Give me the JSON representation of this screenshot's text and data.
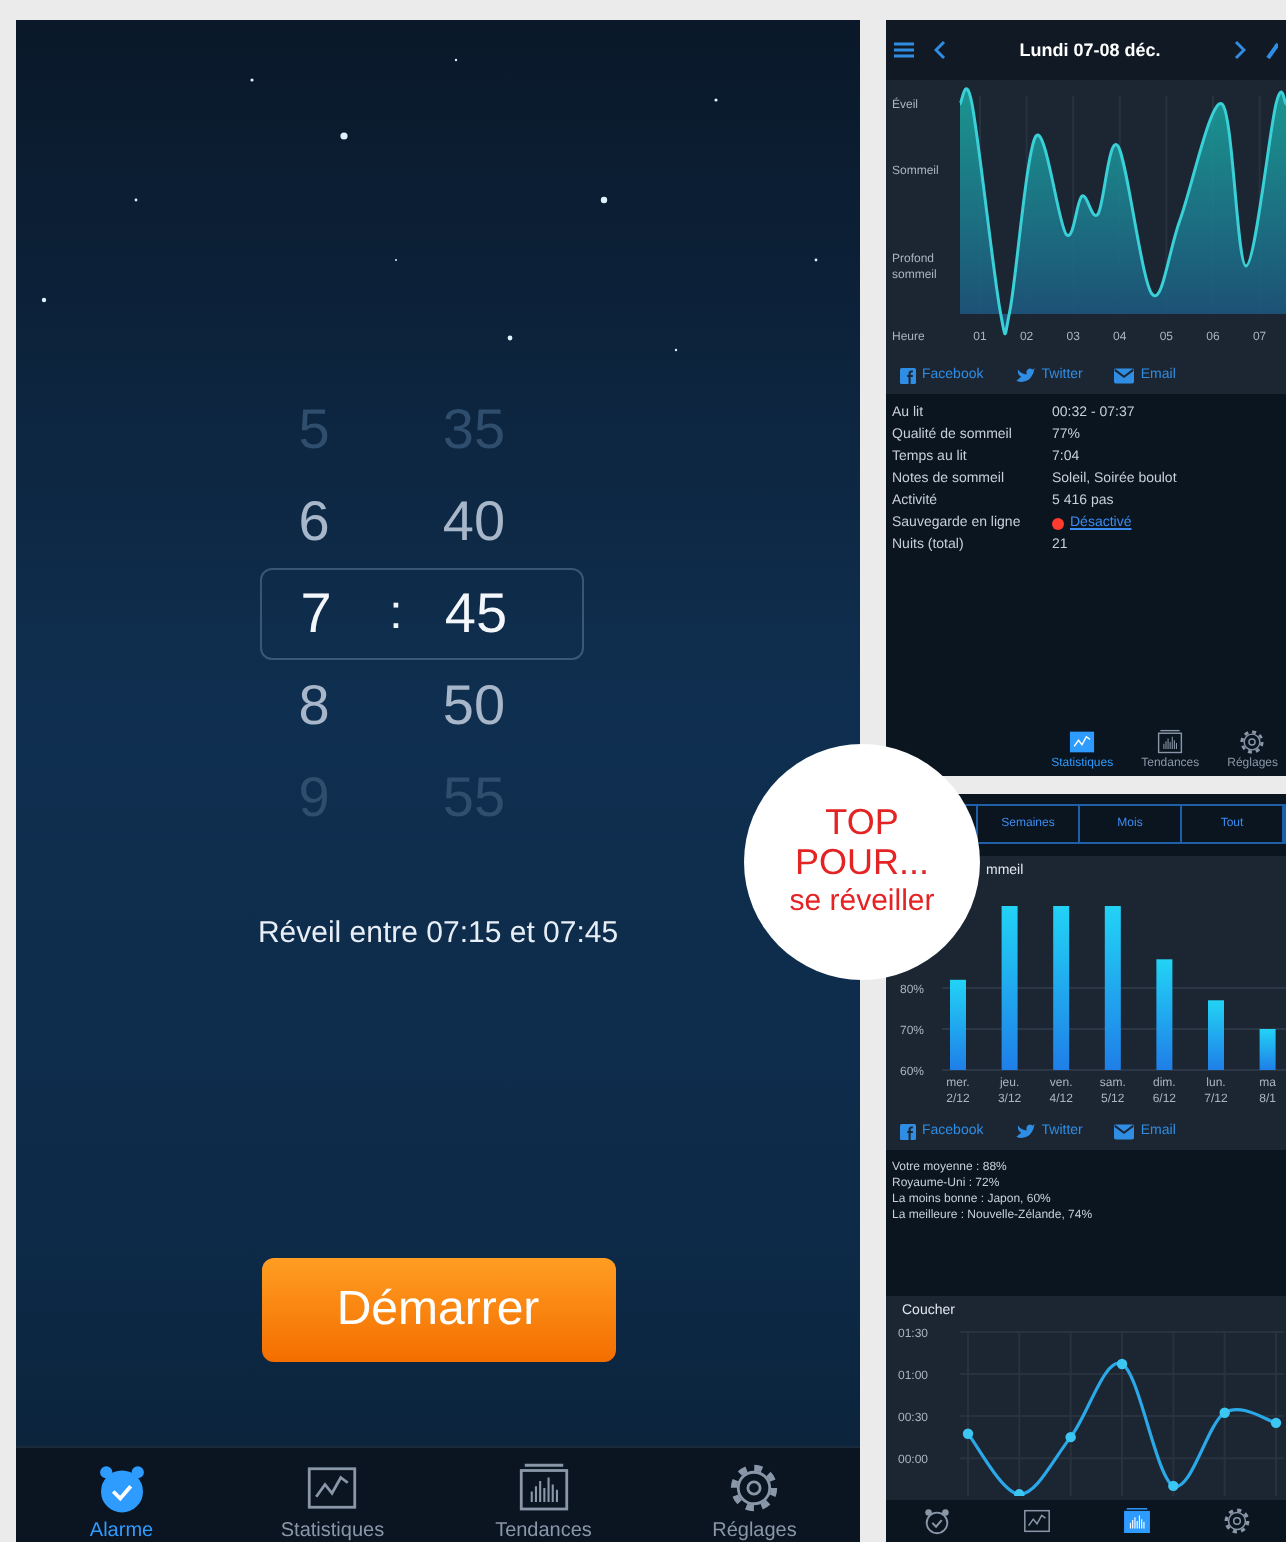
{
  "alarm_screen": {
    "picker": {
      "separator": ":",
      "rows": [
        {
          "hour": "5",
          "minute": "35",
          "selected": false
        },
        {
          "hour": "6",
          "minute": "40",
          "selected": false
        },
        {
          "hour": "7",
          "minute": "45",
          "selected": true
        },
        {
          "hour": "8",
          "minute": "50",
          "selected": false
        },
        {
          "hour": "9",
          "minute": "55",
          "selected": false
        }
      ]
    },
    "wake_window": "Réveil entre 07:15 et 07:45",
    "start_button": "Démarrer",
    "tabs": [
      {
        "label": "Alarme",
        "kind": "alarm",
        "selected": true
      },
      {
        "label": "Statistiques",
        "kind": "stats",
        "selected": false
      },
      {
        "label": "Tendances",
        "kind": "trends",
        "selected": false
      },
      {
        "label": "Réglages",
        "kind": "settings",
        "selected": false
      }
    ]
  },
  "night_screen": {
    "title": "Lundi 07-08 déc.",
    "sleep_graph": {
      "levels": [
        "Éveil",
        "Sommeil",
        "Profond sommeil"
      ],
      "x_title": "Heure",
      "hours": [
        "01",
        "02",
        "03",
        "04",
        "05",
        "06",
        "07"
      ]
    },
    "share": [
      {
        "label": "Facebook",
        "kind": "facebook"
      },
      {
        "label": "Twitter",
        "kind": "twitter"
      },
      {
        "label": "Email",
        "kind": "email"
      }
    ],
    "details": [
      {
        "label": "Au lit",
        "value": "00:32 - 07:37",
        "kind": "text"
      },
      {
        "label": "Qualité de sommeil",
        "value": "77%",
        "kind": "text"
      },
      {
        "label": "Temps au lit",
        "value": "7:04",
        "kind": "text"
      },
      {
        "label": "Notes de sommeil",
        "value": "Soleil, Soirée boulot",
        "kind": "text"
      },
      {
        "label": "Activité",
        "value": "5 416 pas",
        "kind": "text"
      },
      {
        "label": "Sauvegarde en ligne",
        "value": "Désactivé",
        "kind": "link",
        "color": "#ff3b30"
      },
      {
        "label": "Nuits (total)",
        "value": "21",
        "kind": "text"
      }
    ],
    "tabs": [
      {
        "label": "Statistiques",
        "kind": "stats",
        "selected": true
      },
      {
        "label": "Tendances",
        "kind": "trends",
        "selected": false
      },
      {
        "label": "Réglages",
        "kind": "settings",
        "selected": false
      }
    ]
  },
  "trends_screen": {
    "periods": [
      "Semaines",
      "Mois",
      "Tout"
    ],
    "quality_chart": {
      "title": "mmeil",
      "chart_data": {
        "type": "bar",
        "categories": [
          "mer. 2/12",
          "jeu. 3/12",
          "ven. 4/12",
          "sam. 5/12",
          "dim. 6/12",
          "lun. 7/12",
          "ma 8/1"
        ],
        "values": [
          82,
          100,
          100,
          100,
          87,
          77,
          70
        ],
        "ylim": [
          60,
          100
        ],
        "yticks": [
          {
            "value": 60,
            "label": "60%"
          },
          {
            "value": 70,
            "label": "70%"
          },
          {
            "value": 80,
            "label": "80%"
          }
        ]
      }
    },
    "share": [
      {
        "label": "Facebook",
        "kind": "facebook"
      },
      {
        "label": "Twitter",
        "kind": "twitter"
      },
      {
        "label": "Email",
        "kind": "email"
      }
    ],
    "summary": [
      "Votre moyenne : 88%",
      "Royaume-Uni : 72%",
      "La moins bonne : Japon, 60%",
      "La meilleure : Nouvelle-Zélande, 74%"
    ],
    "bedtime_chart": {
      "chart_data": {
        "type": "line",
        "title": "Coucher",
        "grid": true,
        "marker": "o",
        "values": [
          0.29,
          -0.43,
          0.25,
          1.12,
          -0.33,
          0.54,
          0.42
        ],
        "ylim": [
          -0.45,
          1.5
        ],
        "yticks": [
          {
            "value": 0,
            "label": "00:00"
          },
          {
            "value": 0.5,
            "label": "00:30"
          },
          {
            "value": 1,
            "label": "01:00"
          },
          {
            "value": 1.5,
            "label": "01:30"
          }
        ]
      }
    },
    "tabs": [
      {
        "kind": "alarm",
        "selected": false
      },
      {
        "kind": "stats",
        "selected": false
      },
      {
        "kind": "trends",
        "selected": true
      },
      {
        "kind": "settings",
        "selected": false
      }
    ]
  },
  "badge": {
    "lines": [
      "TOP",
      "POUR...",
      "se réveiller"
    ]
  }
}
